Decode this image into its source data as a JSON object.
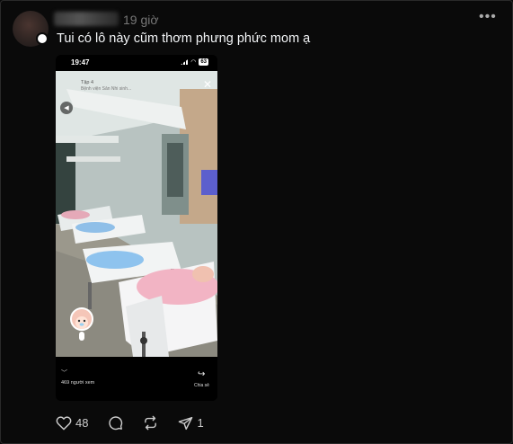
{
  "post": {
    "time": "19 giờ",
    "more_icon": "more-horizontal-icon",
    "caption": "Tui có lô này cũm thơm phưng phức mom ạ"
  },
  "media": {
    "status_time": "19:47",
    "battery": "63",
    "video_title": "Tập 4",
    "video_subtitle": "Bệnh viện Sản Nhi sinh...",
    "viewers": "469 người xem",
    "share_label": "Chia sẻ"
  },
  "actions": {
    "likes": "48",
    "shares": "1"
  },
  "colors": {
    "background": "#0a0a0a",
    "text": "#f3f5f7",
    "muted": "#777777"
  }
}
